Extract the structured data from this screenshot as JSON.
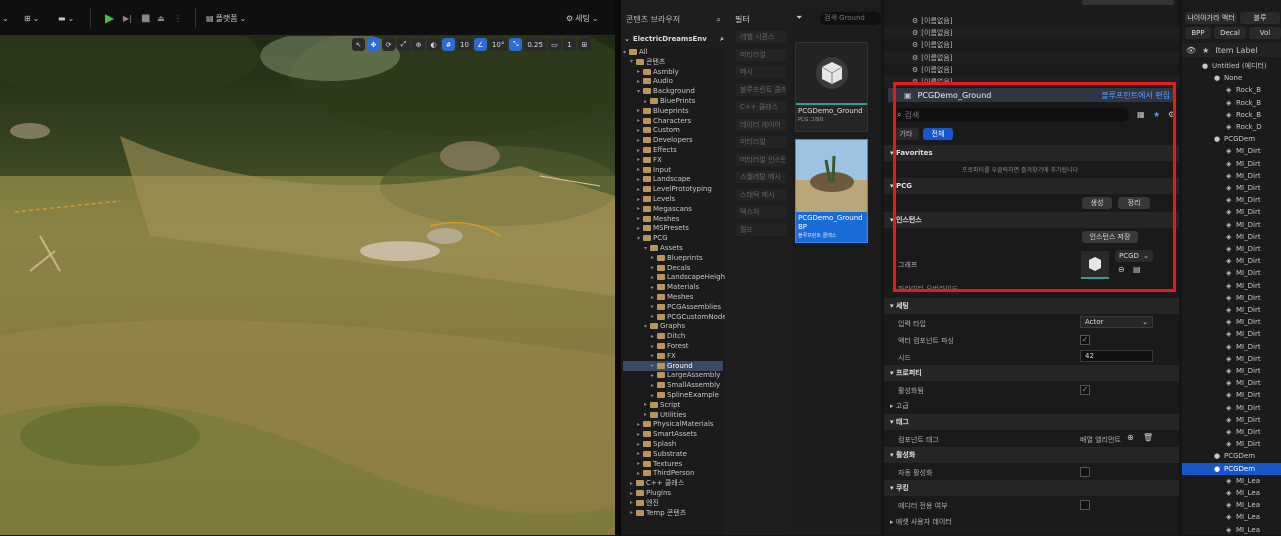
{
  "viewport": {
    "toolbar": {
      "platforms_label": "플랫폼",
      "settings_label": "세팅"
    },
    "overlay": {
      "grid_size": "10",
      "rotation": "10°",
      "scale": "0.25",
      "camera_speed": "1"
    }
  },
  "content_browser": {
    "tab_label": "콘텐츠 브라우저",
    "root_label": "ElectricDreamsEnv",
    "tree": [
      {
        "label": "All",
        "depth": 0,
        "open": true
      },
      {
        "label": "콘텐츠",
        "depth": 1,
        "open": true
      },
      {
        "label": "Asmbly",
        "depth": 2
      },
      {
        "label": "Audio",
        "depth": 2
      },
      {
        "label": "Background",
        "depth": 2,
        "open": true
      },
      {
        "label": "BluePrints",
        "depth": 3
      },
      {
        "label": "Blueprints",
        "depth": 2
      },
      {
        "label": "Characters",
        "depth": 2
      },
      {
        "label": "Custom",
        "depth": 2
      },
      {
        "label": "Developers",
        "depth": 2
      },
      {
        "label": "Effects",
        "depth": 2
      },
      {
        "label": "FX",
        "depth": 2
      },
      {
        "label": "Input",
        "depth": 2
      },
      {
        "label": "Landscape",
        "depth": 2
      },
      {
        "label": "LevelPrototyping",
        "depth": 2
      },
      {
        "label": "Levels",
        "depth": 2
      },
      {
        "label": "Megascans",
        "depth": 2
      },
      {
        "label": "Meshes",
        "depth": 2
      },
      {
        "label": "MSPresets",
        "depth": 2
      },
      {
        "label": "PCG",
        "depth": 2,
        "open": true
      },
      {
        "label": "Assets",
        "depth": 3,
        "open": true
      },
      {
        "label": "Blueprints",
        "depth": 4
      },
      {
        "label": "Decals",
        "depth": 4
      },
      {
        "label": "LandscapeHeightmaps",
        "depth": 4
      },
      {
        "label": "Materials",
        "depth": 4
      },
      {
        "label": "Meshes",
        "depth": 4
      },
      {
        "label": "PCGAssemblies",
        "depth": 4
      },
      {
        "label": "PCGCustomNodes",
        "depth": 4
      },
      {
        "label": "Graphs",
        "depth": 3,
        "open": true
      },
      {
        "label": "Ditch",
        "depth": 4
      },
      {
        "label": "Forest",
        "depth": 4
      },
      {
        "label": "FX",
        "depth": 4
      },
      {
        "label": "Ground",
        "depth": 4,
        "selected": true
      },
      {
        "label": "LargeAssembly",
        "depth": 4
      },
      {
        "label": "SmallAssembly",
        "depth": 4
      },
      {
        "label": "SplineExample",
        "depth": 4
      },
      {
        "label": "Script",
        "depth": 3
      },
      {
        "label": "Utilities",
        "depth": 3
      },
      {
        "label": "PhysicalMaterials",
        "depth": 2
      },
      {
        "label": "SmartAssets",
        "depth": 2
      },
      {
        "label": "Splash",
        "depth": 2
      },
      {
        "label": "Substrate",
        "depth": 2
      },
      {
        "label": "Textures",
        "depth": 2
      },
      {
        "label": "ThirdPerson",
        "depth": 2
      },
      {
        "label": "C++ 클래스",
        "depth": 1
      },
      {
        "label": "Plugins",
        "depth": 1
      },
      {
        "label": "엔진",
        "depth": 1
      },
      {
        "label": "Temp 콘텐츠",
        "depth": 1
      }
    ],
    "filters_title": "필터",
    "filters": [
      "레벨 시퀀스",
      "머티리얼",
      "메시",
      "블루프린트 클래스",
      "C++ 클래스",
      "데이터 레이어",
      "머티리얼",
      "머티리얼 인스턴스",
      "스켈레탈 메시",
      "스태틱 메시",
      "텍스처",
      "월드"
    ],
    "search_placeholder": "검색 Ground",
    "assets": [
      {
        "name": "PCGDemo_Ground",
        "kind": "PCG 그래프"
      },
      {
        "name": "PCGDemo_Ground BP",
        "kind": "블루프린트 클래스"
      }
    ]
  },
  "details": {
    "components": [
      "[이름없음]",
      "[이름없음]",
      "[이름없음]",
      "[이름없음]",
      "[이름없음]",
      "[이름없음]"
    ],
    "selected_title": "PCGDemo_Ground",
    "edit_link": "블루프린트에서 편집",
    "search_placeholder": "검색",
    "tabs": [
      "기타",
      "전체"
    ],
    "sections": {
      "favorites": "Favorites",
      "favorites_hint": "프로퍼티를 우클릭하면 즐겨찾기에 추가됩니다",
      "pcg": "PCG",
      "generate_label": "생성",
      "cleanup_label": "정리",
      "instance": "인스턴스",
      "save_instance_label": "인스턴스 저장",
      "graph_label": "그래프",
      "graph_value": "PCGD",
      "params_label": "파라미터 오버라이드",
      "settings": "세팅",
      "input_type_label": "입력 타입",
      "input_type_value": "Actor",
      "parse_actor_label": "액터 컴포넌트 파싱",
      "seed_label": "시드",
      "seed_value": "42",
      "properties": "프로퍼티",
      "activated_label": "활성화됨",
      "runtime": "고급",
      "tags": "태그",
      "component_tags_label": "컴포넌트 태그",
      "component_tags_value": "배열 엘리먼트",
      "activation": "활성화",
      "auto_activate_label": "자동 활성화",
      "cooking": "쿠킹",
      "editor_only_label": "에디터 전용 여부",
      "asset_user_data": "에셋 사용자 데이터"
    }
  },
  "outliner": {
    "top_buttons": [
      "나이아가라 액터",
      "블루"
    ],
    "filters": [
      "BPP",
      "Decal",
      "Vol"
    ],
    "column_label": "Item Label",
    "rows": [
      {
        "label": "Untitled (에디터)",
        "depth": 0
      },
      {
        "label": "None",
        "depth": 1
      },
      {
        "label": "Rock_B",
        "depth": 2
      },
      {
        "label": "Rock_B",
        "depth": 2
      },
      {
        "label": "Rock_B",
        "depth": 2
      },
      {
        "label": "Rock_D",
        "depth": 2
      },
      {
        "label": "PCGDem",
        "depth": 1
      },
      {
        "label": "MI_Dirt",
        "depth": 2
      },
      {
        "label": "MI_Dirt",
        "depth": 2
      },
      {
        "label": "MI_Dirt",
        "depth": 2
      },
      {
        "label": "MI_Dirt",
        "depth": 2
      },
      {
        "label": "MI_Dirt",
        "depth": 2
      },
      {
        "label": "MI_Dirt",
        "depth": 2
      },
      {
        "label": "MI_Dirt",
        "depth": 2
      },
      {
        "label": "MI_Dirt",
        "depth": 2
      },
      {
        "label": "MI_Dirt",
        "depth": 2
      },
      {
        "label": "MI_Dirt",
        "depth": 2
      },
      {
        "label": "MI_Dirt",
        "depth": 2
      },
      {
        "label": "MI_Dirt",
        "depth": 2
      },
      {
        "label": "MI_Dirt",
        "depth": 2
      },
      {
        "label": "MI_Dirt",
        "depth": 2
      },
      {
        "label": "MI_Dirt",
        "depth": 2
      },
      {
        "label": "MI_Dirt",
        "depth": 2
      },
      {
        "label": "MI_Dirt",
        "depth": 2
      },
      {
        "label": "MI_Dirt",
        "depth": 2
      },
      {
        "label": "MI_Dirt",
        "depth": 2
      },
      {
        "label": "MI_Dirt",
        "depth": 2
      },
      {
        "label": "MI_Dirt",
        "depth": 2
      },
      {
        "label": "MI_Dirt",
        "depth": 2
      },
      {
        "label": "MI_Dirt",
        "depth": 2
      },
      {
        "label": "MI_Dirt",
        "depth": 2
      },
      {
        "label": "MI_Dirt",
        "depth": 2
      },
      {
        "label": "PCGDem",
        "depth": 1
      },
      {
        "label": "PCGDem",
        "depth": 1,
        "selected": true
      },
      {
        "label": "MI_Lea",
        "depth": 2
      },
      {
        "label": "MI_Lea",
        "depth": 2
      },
      {
        "label": "MI_Lea",
        "depth": 2
      },
      {
        "label": "MI_Lea",
        "depth": 2
      },
      {
        "label": "MI_Lea",
        "depth": 2
      }
    ]
  }
}
